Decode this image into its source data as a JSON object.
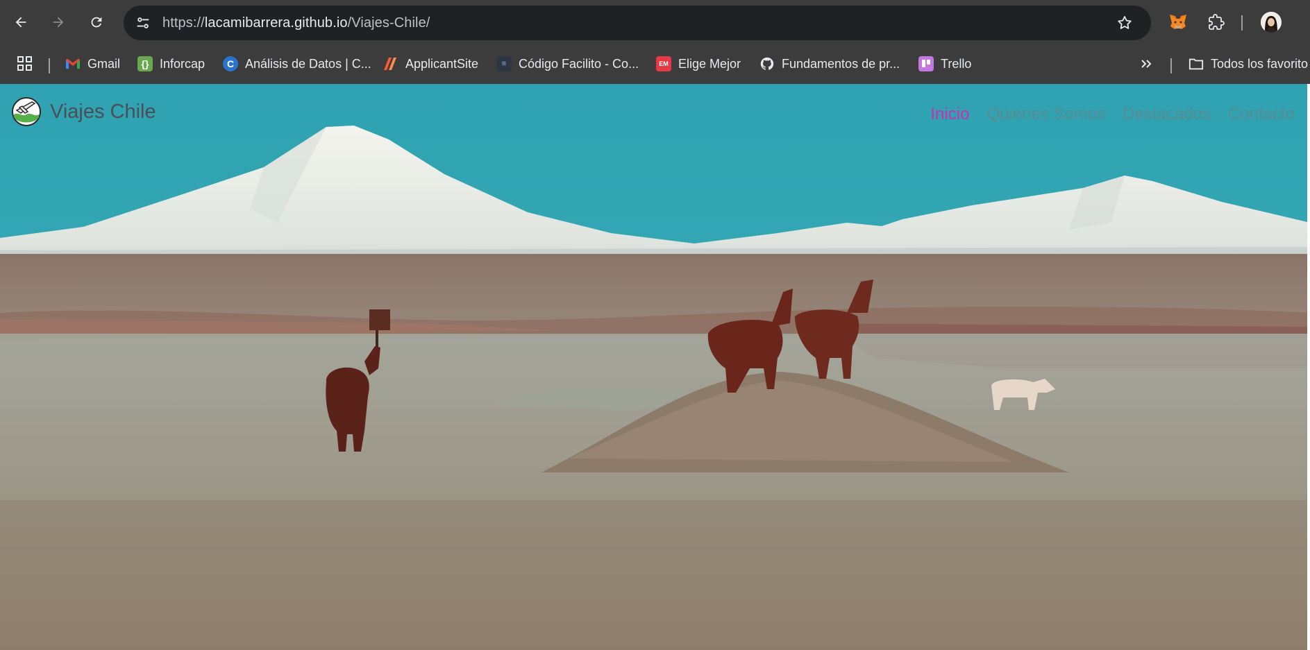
{
  "browser": {
    "url_prefix": "https://",
    "url_host": "lacamibarrera.github.io",
    "url_path": "/Viajes-Chile/",
    "icons": {
      "back": "arrow-left-icon",
      "forward": "arrow-right-icon",
      "reload": "reload-icon",
      "site_info": "tune-icon",
      "bookmark_star": "star-icon",
      "metamask": "fox-icon",
      "extensions": "puzzle-icon",
      "apps": "apps-grid-icon",
      "overflow": "double-chevron-icon",
      "folder": "folder-icon"
    }
  },
  "bookmarks": {
    "items": [
      {
        "label": "Gmail",
        "icon": "gmail-icon",
        "color": "#ea4335"
      },
      {
        "label": "Inforcap",
        "icon": "inforcap-icon",
        "color": "#6aa84f"
      },
      {
        "label": "Análisis de Datos | C...",
        "icon": "coursera-icon",
        "color": "#2a73cc"
      },
      {
        "label": "ApplicantSite",
        "icon": "applicantsite-icon",
        "color": "#ff5a36"
      },
      {
        "label": "Código Facilito - Co...",
        "icon": "codigofacilito-icon",
        "color": "#2f3542"
      },
      {
        "label": "Elige Mejor",
        "icon": "eligemejor-icon",
        "color": "#e63946"
      },
      {
        "label": "Fundamentos de pr...",
        "icon": "github-icon",
        "color": "#e8eaed"
      },
      {
        "label": "Trello",
        "icon": "trello-icon",
        "color": "#c377e0"
      }
    ],
    "all_label": "Todos los favorito"
  },
  "site": {
    "brand": "Viajes Chile",
    "menu": [
      {
        "label": "Inicio",
        "active": true
      },
      {
        "label": "Quienes Somos",
        "active": false
      },
      {
        "label": "Destacados",
        "active": false
      },
      {
        "label": "Contacto",
        "active": false
      }
    ],
    "colors": {
      "active_link": "#cc2fae",
      "sky": "#34a9b6"
    }
  }
}
